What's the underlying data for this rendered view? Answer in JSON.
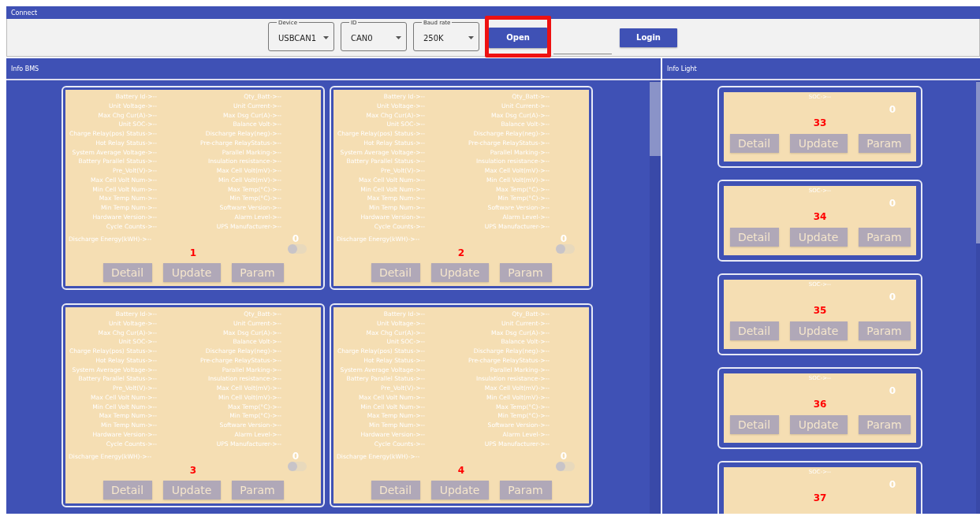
{
  "window": {
    "title": "Connect"
  },
  "connection": {
    "fields": [
      {
        "label": "Device",
        "value": "USBCAN1"
      },
      {
        "label": "ID",
        "value": "CAN0"
      },
      {
        "label": "Baud rate",
        "value": "250K"
      }
    ],
    "open_button": {
      "label": "Open",
      "highlighted": true
    },
    "login_button": "Login"
  },
  "bms_panel": {
    "title": "Info BMS",
    "cards": [
      {
        "number": "1",
        "rows": [
          {
            "left": "Battery Id->--",
            "right": "Qty_Batt->--"
          },
          {
            "left": "Unit Voltage->--",
            "right": "Unit Current->--"
          },
          {
            "left": "Max Chg Cur(A)->--",
            "right": "Max Dsg Cur(A)->--"
          },
          {
            "left": "Unit SOC->--",
            "right": "Balance Volt->--"
          },
          {
            "left": "Charge Relay(pos) Status->--",
            "right": "Discharge Relay(neg)->--"
          },
          {
            "left": "Hot Relay Status->--",
            "right": "Pre-charge RelayStatus->--"
          },
          {
            "left": "System Average Voltage->--",
            "right": "Parallel Marking->--"
          },
          {
            "left": "Battery Parallel Status->--",
            "right": "Insulation resistance->--"
          },
          {
            "left": "Pre_Volt(V)->--",
            "right": "Max Cell Volt(mV)->--"
          },
          {
            "left": "Max Cell Volt Num->--",
            "right": "Min Cell Volt(mV)->--"
          },
          {
            "left": "Min Cell Volt Num->--",
            "right": "Max Temp(°C)->--"
          },
          {
            "left": "Max Temp Num->--",
            "right": "Min Temp(°C)->--"
          },
          {
            "left": "Min Temp Num->--",
            "right": "Software Version->--"
          },
          {
            "left": "Hardware Version->--",
            "right": "Alarm Level->--"
          },
          {
            "left": "Cycle Counts->--",
            "right": "UPS Manufacturer->--"
          }
        ],
        "energy_label": "Discharge Energy(kWH)->--",
        "energy_value": "0",
        "switch_on": false,
        "buttons": [
          "Detail",
          "Update",
          "Param"
        ]
      },
      {
        "number": "2",
        "rows": [
          {
            "left": "Battery Id->--",
            "right": "Qty_Batt->--"
          },
          {
            "left": "Unit Voltage->--",
            "right": "Unit Current->--"
          },
          {
            "left": "Max Chg Cur(A)->--",
            "right": "Max Dsg Cur(A)->--"
          },
          {
            "left": "Unit SOC->--",
            "right": "Balance Volt->--"
          },
          {
            "left": "Charge Relay(pos) Status->--",
            "right": "Discharge Relay(neg)->--"
          },
          {
            "left": "Hot Relay Status->--",
            "right": "Pre-charge RelayStatus->--"
          },
          {
            "left": "System Average Voltage->--",
            "right": "Parallel Marking->--"
          },
          {
            "left": "Battery Parallel Status->--",
            "right": "Insulation resistance->--"
          },
          {
            "left": "Pre_Volt(V)->--",
            "right": "Max Cell Volt(mV)->--"
          },
          {
            "left": "Max Cell Volt Num->--",
            "right": "Min Cell Volt(mV)->--"
          },
          {
            "left": "Min Cell Volt Num->--",
            "right": "Max Temp(°C)->--"
          },
          {
            "left": "Max Temp Num->--",
            "right": "Min Temp(°C)->--"
          },
          {
            "left": "Min Temp Num->--",
            "right": "Software Version->--"
          },
          {
            "left": "Hardware Version->--",
            "right": "Alarm Level->--"
          },
          {
            "left": "Cycle Counts->--",
            "right": "UPS Manufacturer->--"
          }
        ],
        "energy_label": "Discharge Energy(kWH)->--",
        "energy_value": "0",
        "switch_on": false,
        "buttons": [
          "Detail",
          "Update",
          "Param"
        ]
      },
      {
        "number": "3",
        "rows": [
          {
            "left": "Battery Id->--",
            "right": "Qty_Batt->--"
          },
          {
            "left": "Unit Voltage->--",
            "right": "Unit Current->--"
          },
          {
            "left": "Max Chg Cur(A)->--",
            "right": "Max Dsg Cur(A)->--"
          },
          {
            "left": "Unit SOC->--",
            "right": "Balance Volt->--"
          },
          {
            "left": "Charge Relay(pos) Status->--",
            "right": "Discharge Relay(neg)->--"
          },
          {
            "left": "Hot Relay Status->--",
            "right": "Pre-charge RelayStatus->--"
          },
          {
            "left": "System Average Voltage->--",
            "right": "Parallel Marking->--"
          },
          {
            "left": "Battery Parallel Status->--",
            "right": "Insulation resistance->--"
          },
          {
            "left": "Pre_Volt(V)->--",
            "right": "Max Cell Volt(mV)->--"
          },
          {
            "left": "Max Cell Volt Num->--",
            "right": "Min Cell Volt(mV)->--"
          },
          {
            "left": "Min Cell Volt Num->--",
            "right": "Max Temp(°C)->--"
          },
          {
            "left": "Max Temp Num->--",
            "right": "Min Temp(°C)->--"
          },
          {
            "left": "Min Temp Num->--",
            "right": "Software Version->--"
          },
          {
            "left": "Hardware Version->--",
            "right": "Alarm Level->--"
          },
          {
            "left": "Cycle Counts->--",
            "right": "UPS Manufacturer->--"
          }
        ],
        "energy_label": "Discharge Energy(kWH)->--",
        "energy_value": "0",
        "switch_on": false,
        "buttons": [
          "Detail",
          "Update",
          "Param"
        ]
      },
      {
        "number": "4",
        "rows": [
          {
            "left": "Battery Id->--",
            "right": "Qty_Batt->--"
          },
          {
            "left": "Unit Voltage->--",
            "right": "Unit Current->--"
          },
          {
            "left": "Max Chg Cur(A)->--",
            "right": "Max Dsg Cur(A)->--"
          },
          {
            "left": "Unit SOC->--",
            "right": "Balance Volt->--"
          },
          {
            "left": "Charge Relay(pos) Status->--",
            "right": "Discharge Relay(neg)->--"
          },
          {
            "left": "Hot Relay Status->--",
            "right": "Pre-charge RelayStatus->--"
          },
          {
            "left": "System Average Voltage->--",
            "right": "Parallel Marking->--"
          },
          {
            "left": "Battery Parallel Status->--",
            "right": "Insulation resistance->--"
          },
          {
            "left": "Pre_Volt(V)->--",
            "right": "Max Cell Volt(mV)->--"
          },
          {
            "left": "Max Cell Volt Num->--",
            "right": "Min Cell Volt(mV)->--"
          },
          {
            "left": "Min Cell Volt Num->--",
            "right": "Max Temp(°C)->--"
          },
          {
            "left": "Max Temp Num->--",
            "right": "Min Temp(°C)->--"
          },
          {
            "left": "Min Temp Num->--",
            "right": "Software Version->--"
          },
          {
            "left": "Hardware Version->--",
            "right": "Alarm Level->--"
          },
          {
            "left": "Cycle Counts->--",
            "right": "UPS Manufacturer->--"
          }
        ],
        "energy_label": "Discharge Energy(kWH)->--",
        "energy_value": "0",
        "switch_on": false,
        "buttons": [
          "Detail",
          "Update",
          "Param"
        ]
      }
    ]
  },
  "light_panel": {
    "title": "Info Light",
    "cards": [
      {
        "soc": "SOC->--",
        "value": "0",
        "number": "33",
        "buttons": [
          "Detail",
          "Update",
          "Param"
        ]
      },
      {
        "soc": "SOC->--",
        "value": "0",
        "number": "34",
        "buttons": [
          "Detail",
          "Update",
          "Param"
        ]
      },
      {
        "soc": "SOC->--",
        "value": "0",
        "number": "35",
        "buttons": [
          "Detail",
          "Update",
          "Param"
        ]
      },
      {
        "soc": "SOC->--",
        "value": "0",
        "number": "36",
        "buttons": [
          "Detail",
          "Update",
          "Param"
        ]
      },
      {
        "soc": "SOC->--",
        "value": "0",
        "number": "37"
      }
    ]
  }
}
